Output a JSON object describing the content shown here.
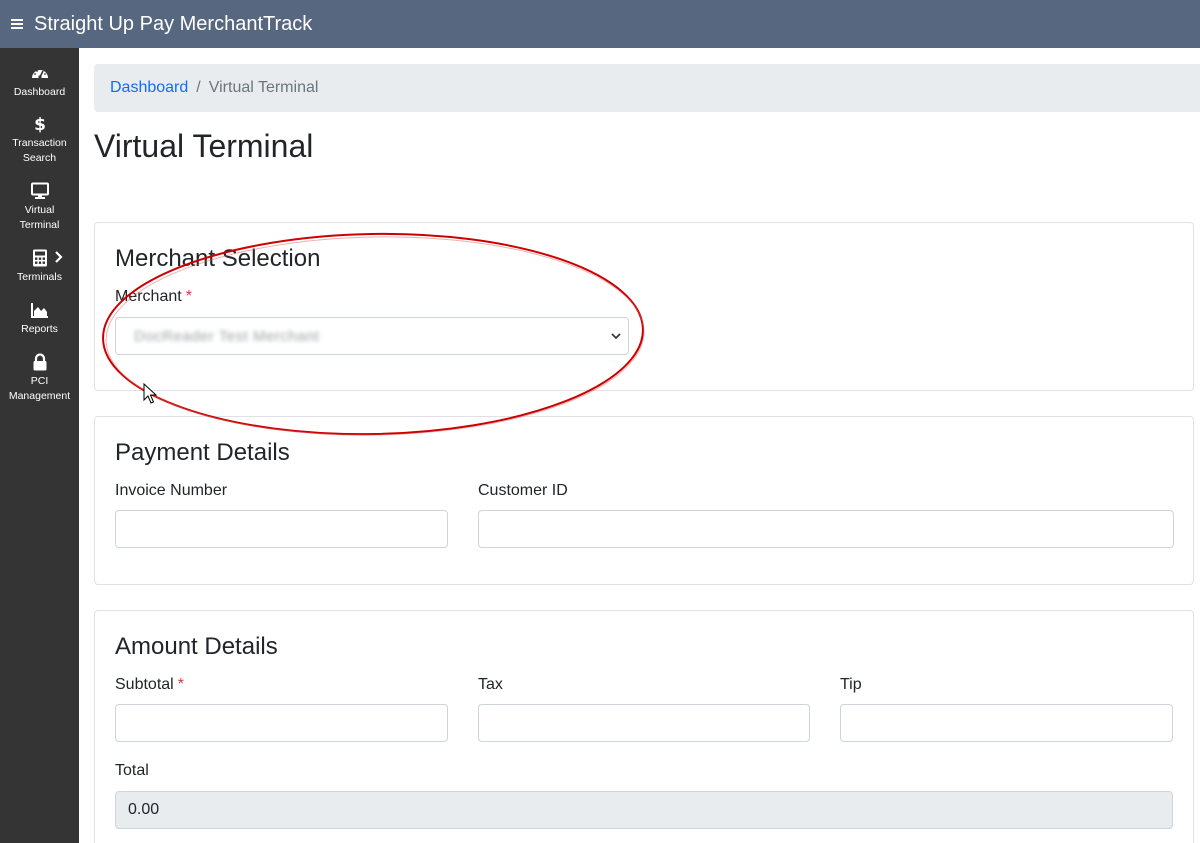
{
  "app": {
    "title": "Straight Up Pay MerchantTrack",
    "menu_icon": "hamburger-menu-icon"
  },
  "sidebar": {
    "items": [
      {
        "label_lines": [
          "Dashboard"
        ],
        "icon": "gauge-icon"
      },
      {
        "label_lines": [
          "Transaction",
          "Search"
        ],
        "icon": "dollar-icon"
      },
      {
        "label_lines": [
          "Virtual",
          "Terminal"
        ],
        "icon": "monitor-icon"
      },
      {
        "label_lines": [
          "Terminals"
        ],
        "icon": "calculator-icon",
        "has_submenu": true
      },
      {
        "label_lines": [
          "Reports"
        ],
        "icon": "area-chart-icon"
      },
      {
        "label_lines": [
          "PCI",
          "Management"
        ],
        "icon": "lock-icon"
      }
    ]
  },
  "breadcrumb": {
    "home": "Dashboard",
    "separator": "/",
    "current": "Virtual Terminal"
  },
  "page": {
    "title": "Virtual Terminal"
  },
  "merchant_selection": {
    "title": "Merchant Selection",
    "merchant_label": "Merchant",
    "required_mark": "*",
    "merchant_value": "DocReader Test Merchant"
  },
  "payment_details": {
    "title": "Payment Details",
    "invoice_label": "Invoice Number",
    "invoice_value": "",
    "customer_label": "Customer ID",
    "customer_value": ""
  },
  "amount_details": {
    "title": "Amount Details",
    "subtotal_label": "Subtotal",
    "required_mark": "*",
    "subtotal_value": "",
    "tax_label": "Tax",
    "tax_value": "",
    "tip_label": "Tip",
    "tip_value": "",
    "total_label": "Total",
    "total_value": "0.00"
  },
  "colors": {
    "topbar": "#56677f",
    "sidebar": "#343434",
    "link": "#0d6efd",
    "required": "#dc3545",
    "annotation": "#cc0000"
  }
}
